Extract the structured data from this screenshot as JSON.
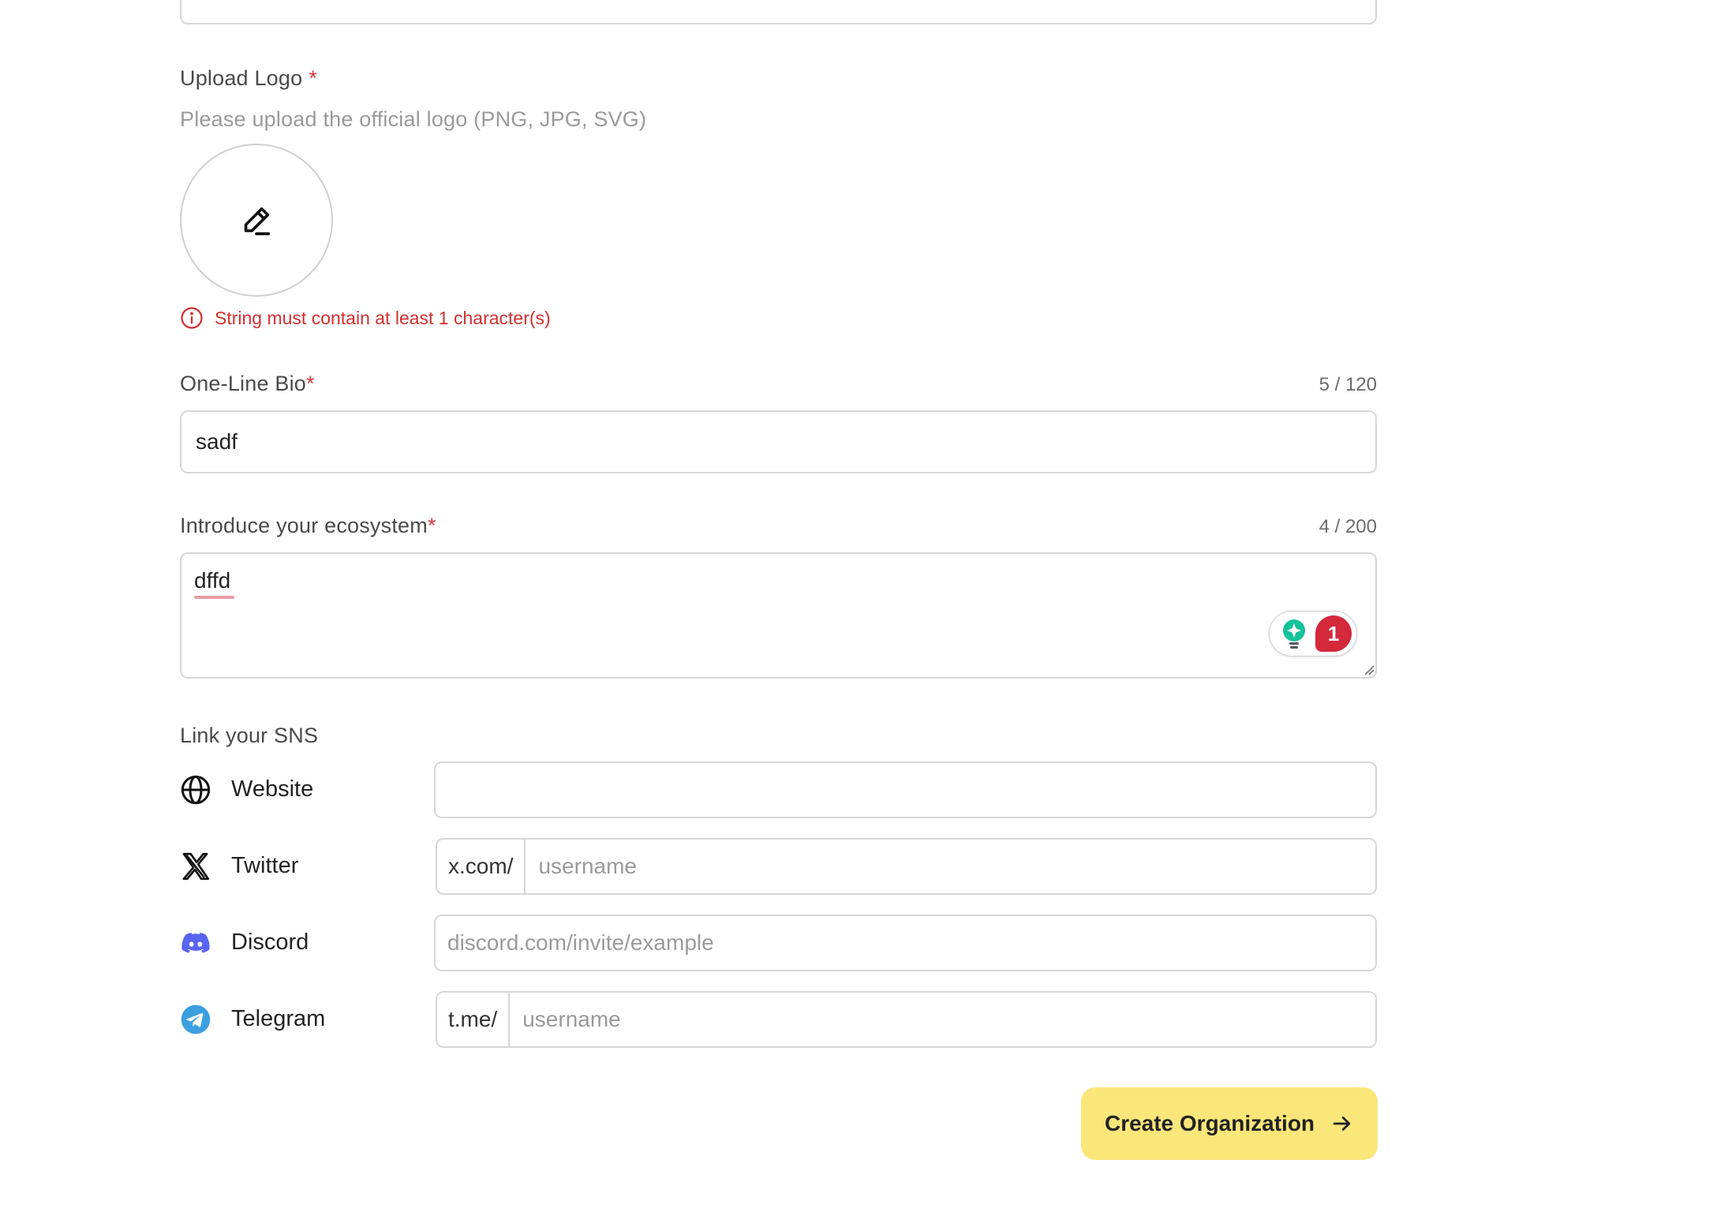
{
  "logo": {
    "label": "Upload Logo",
    "required_mark": "*",
    "hint": "Please upload the official logo (PNG, JPG, SVG)",
    "edit_icon": "pencil-icon",
    "error": "String must contain at least 1 character(s)",
    "error_icon": "info-circle-icon"
  },
  "bio": {
    "label": "One-Line Bio",
    "required_mark": "*",
    "counter": "5 / 120",
    "value": "sadf"
  },
  "ecosystem": {
    "label": "Introduce your ecosystem",
    "required_mark": "*",
    "counter": "4 / 200",
    "value": "dffd",
    "assistant_issue_count": "1",
    "assistant_icon": "lightbulb-icon"
  },
  "sns": {
    "label": "Link your SNS",
    "website": {
      "name": "Website",
      "icon": "globe-icon",
      "value": ""
    },
    "twitter": {
      "name": "Twitter",
      "icon": "x-logo-icon",
      "prefix": "x.com/",
      "placeholder": "username"
    },
    "discord": {
      "name": "Discord",
      "icon": "discord-icon",
      "placeholder": "discord.com/invite/example"
    },
    "telegram": {
      "name": "Telegram",
      "icon": "telegram-icon",
      "prefix": "t.me/",
      "placeholder": "username"
    }
  },
  "submit": {
    "label": "Create Organization",
    "icon": "arrow-right-icon"
  },
  "colors": {
    "error": "#d32f2f",
    "required": "#d9363e",
    "button_bg": "#fbe67a",
    "discord": "#5865f2",
    "telegram": "#3b9fe0",
    "assistant_green": "#15c39a",
    "assistant_badge": "#d4283b"
  }
}
